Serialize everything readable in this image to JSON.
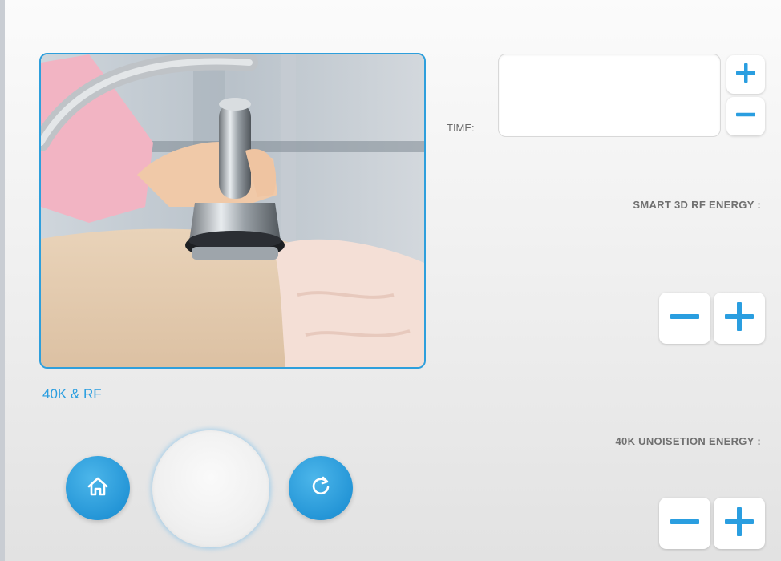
{
  "mode": {
    "title": "40K & RF"
  },
  "time": {
    "label": "TIME:",
    "value": ""
  },
  "energy": {
    "rf_label": "SMART 3D RF ENERGY :",
    "cavitation_label": "40K UNOISETION ENERGY :"
  },
  "colors": {
    "accent": "#2a9ee0",
    "accent_dark": "#1d88c8",
    "button_bg": "#ffffff"
  },
  "icons": {
    "home": "home-icon",
    "reset": "refresh-icon",
    "plus": "plus-icon",
    "minus": "minus-icon"
  }
}
